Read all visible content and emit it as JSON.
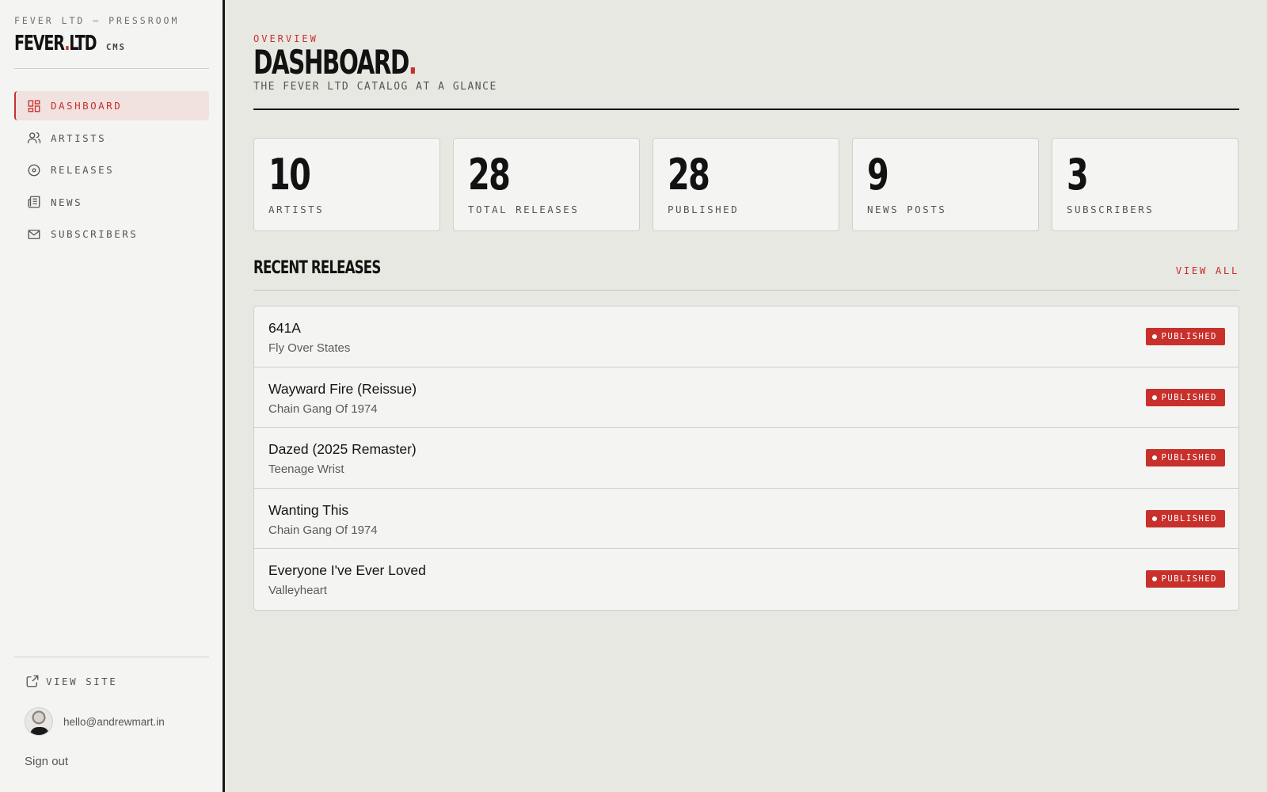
{
  "brand": {
    "kicker": "FEVER LTD — PRESSROOM",
    "logo_main": "FEVER",
    "logo_dot": ".",
    "logo_tail": "LTD",
    "cms": "CMS"
  },
  "nav": [
    {
      "label": "DASHBOARD",
      "icon": "dashboard-icon",
      "active": true
    },
    {
      "label": "ARTISTS",
      "icon": "users-icon",
      "active": false
    },
    {
      "label": "RELEASES",
      "icon": "disc-icon",
      "active": false
    },
    {
      "label": "NEWS",
      "icon": "newspaper-icon",
      "active": false
    },
    {
      "label": "SUBSCRIBERS",
      "icon": "mail-icon",
      "active": false
    }
  ],
  "sidebar_footer": {
    "view_site": "VIEW SITE",
    "email": "hello@andrewmart.in",
    "sign_out": "Sign out"
  },
  "header": {
    "kicker": "OVERVIEW",
    "title": "DASHBOARD",
    "title_dot": ".",
    "subtitle": "THE FEVER LTD CATALOG AT A GLANCE"
  },
  "stats": [
    {
      "value": "10",
      "label": "ARTISTS"
    },
    {
      "value": "28",
      "label": "TOTAL RELEASES"
    },
    {
      "value": "28",
      "label": "PUBLISHED"
    },
    {
      "value": "9",
      "label": "NEWS POSTS"
    },
    {
      "value": "3",
      "label": "SUBSCRIBERS"
    }
  ],
  "recent": {
    "title": "RECENT RELEASES",
    "view_all": "VIEW ALL",
    "items": [
      {
        "title": "641A",
        "artist": "Fly Over States",
        "status": "PUBLISHED"
      },
      {
        "title": "Wayward Fire (Reissue)",
        "artist": "Chain Gang Of 1974",
        "status": "PUBLISHED"
      },
      {
        "title": "Dazed (2025 Remaster)",
        "artist": "Teenage Wrist",
        "status": "PUBLISHED"
      },
      {
        "title": "Wanting This",
        "artist": "Chain Gang Of 1974",
        "status": "PUBLISHED"
      },
      {
        "title": "Everyone I've Ever Loved",
        "artist": "Valleyheart",
        "status": "PUBLISHED"
      }
    ]
  },
  "colors": {
    "accent": "#c8302c",
    "background": "#e8e8e3",
    "panel": "#f4f4f2",
    "ink": "#121212"
  }
}
